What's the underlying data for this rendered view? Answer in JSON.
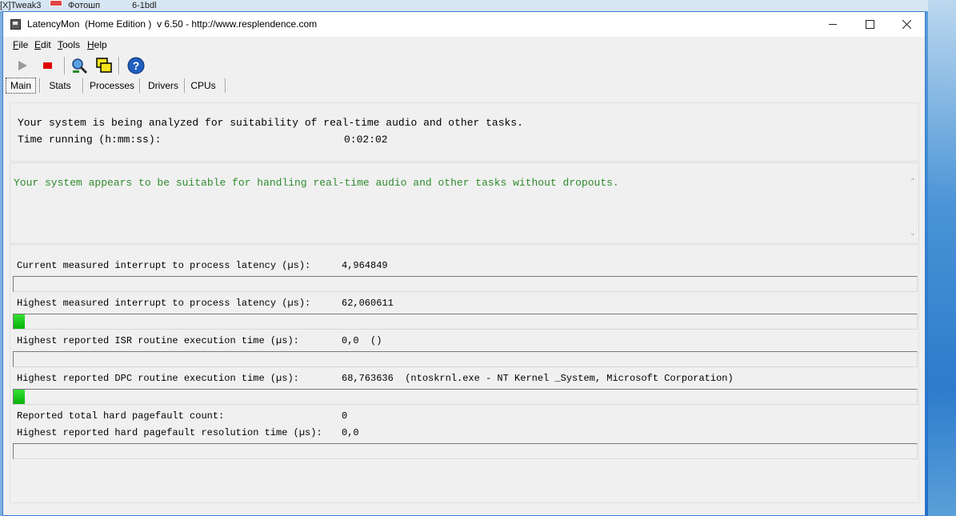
{
  "window": {
    "title": "LatencyMon  (Home Edition )  v 6.50 - http://www.resplendence.com"
  },
  "desktop": {
    "text_left": "[X]Tweak3",
    "text_mid": "Фотошп",
    "text_right": "6-1bdl"
  },
  "menu": {
    "file": "F",
    "file_rest": "ile",
    "edit": "E",
    "edit_rest": "dit",
    "tools": "T",
    "tools_rest": "ools",
    "help": "H",
    "help_rest": "elp"
  },
  "toolbar": {
    "icons": [
      "play-icon",
      "stop-icon",
      "analyze-icon",
      "windows-icon",
      "help-icon"
    ]
  },
  "tabs": [
    "Main",
    "Stats",
    "Processes",
    "Drivers",
    "CPUs"
  ],
  "status": {
    "line1": "Your system is being analyzed for suitability of real-time audio and other tasks.",
    "time_label": "Time running (h:mm:ss):",
    "time_value": "0:02:02",
    "verdict": "Your system appears to be suitable for handling real-time audio and other tasks without dropouts."
  },
  "metrics": [
    {
      "label": "Current measured interrupt to process latency (µs):",
      "value": "4,964849",
      "level": 0
    },
    {
      "label": "Highest measured interrupt to process latency (µs):",
      "value": "62,060611",
      "level": 0.012
    },
    {
      "label": "Highest reported ISR routine execution time (µs):",
      "value": "0,0  ()",
      "level": 0
    },
    {
      "label": "Highest reported DPC routine execution time (µs):",
      "value": "68,763636  (ntoskrnl.exe - NT Kernel _System, Microsoft Corporation)",
      "level": 0.012
    },
    {
      "label": "Reported total hard pagefault count:",
      "value": "0"
    },
    {
      "label": "Highest reported hard pagefault resolution time (µs):",
      "value": "0,0",
      "level": 0
    }
  ],
  "colors": {
    "accent_green": "#0ab10a",
    "verdict_green": "#2e8b2e",
    "window_border": "#3b7ad0"
  }
}
